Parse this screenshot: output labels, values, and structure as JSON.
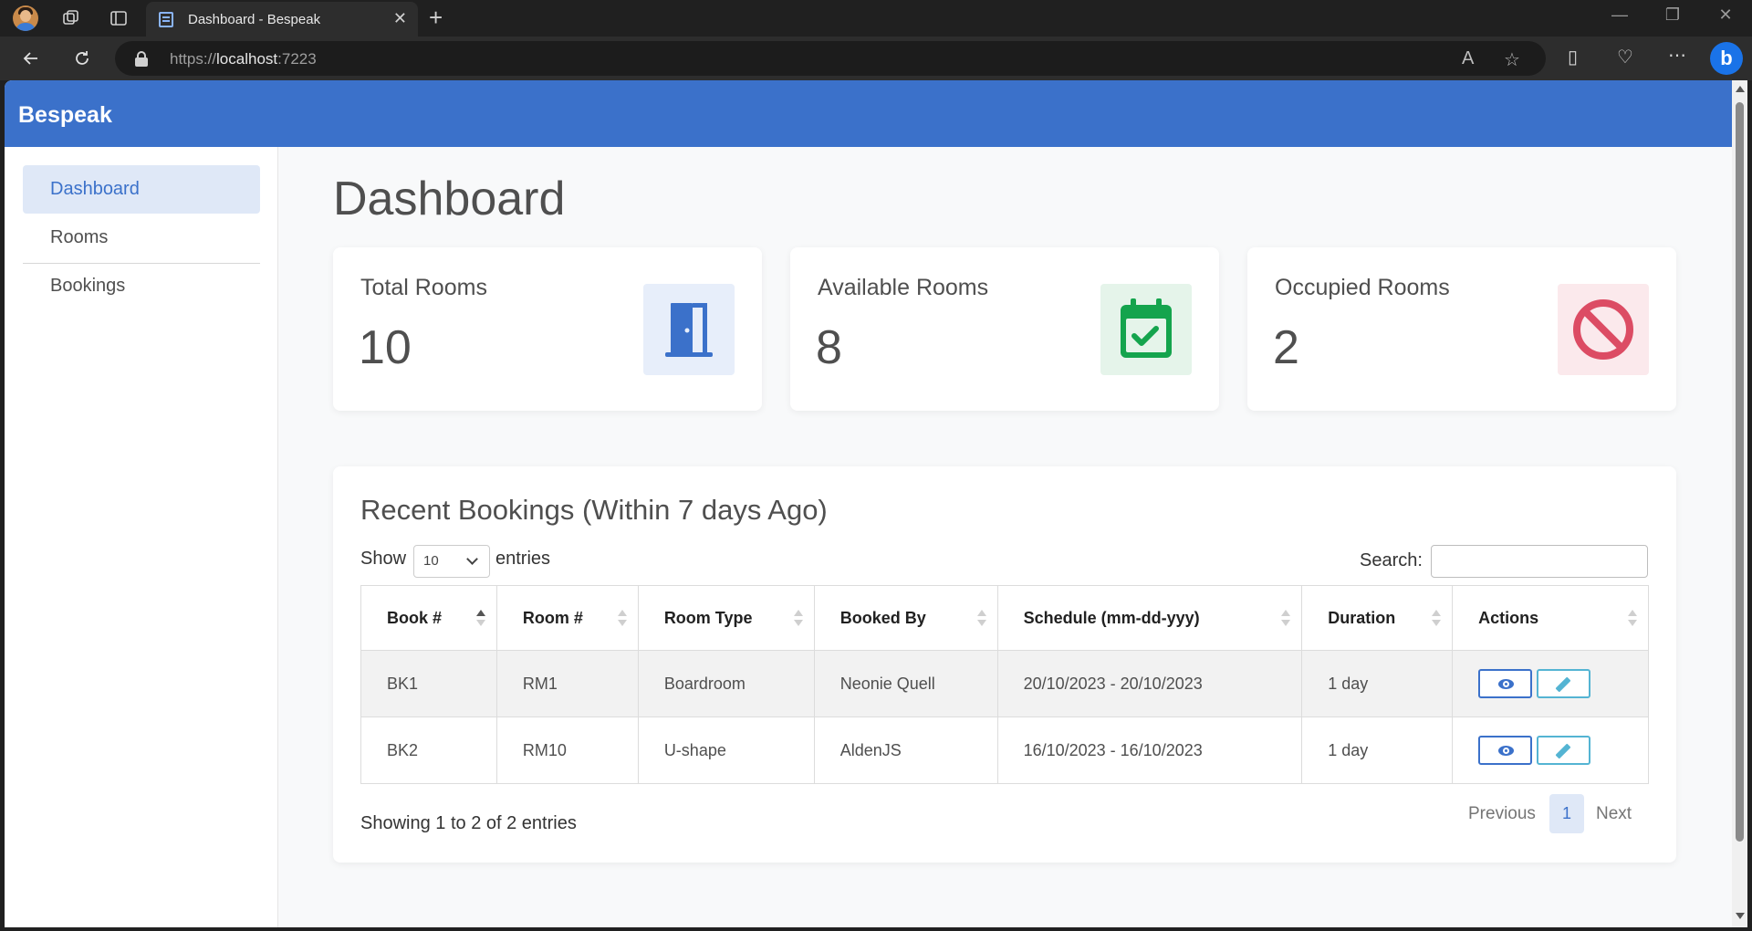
{
  "browser": {
    "tab_title": "Dashboard - Bespeak",
    "url_scheme": "https://",
    "url_host": "localhost",
    "url_port": ":7223"
  },
  "app": {
    "brand": "Bespeak"
  },
  "sidebar": {
    "items": [
      {
        "label": "Dashboard",
        "active": true
      },
      {
        "label": "Rooms",
        "active": false
      },
      {
        "label": "Bookings",
        "active": false
      }
    ]
  },
  "page": {
    "title": "Dashboard"
  },
  "stats": [
    {
      "label": "Total Rooms",
      "value": "10",
      "icon": "door-icon",
      "color": "#3b71ca",
      "bg": "#e7eefa"
    },
    {
      "label": "Available Rooms",
      "value": "8",
      "icon": "calendar-check-icon",
      "color": "#14a44d",
      "bg": "#e5f4ea"
    },
    {
      "label": "Occupied Rooms",
      "value": "2",
      "icon": "ban-icon",
      "color": "#dc4c64",
      "bg": "#fbe9ec"
    }
  ],
  "recent": {
    "title": "Recent Bookings (Within 7 days Ago)",
    "show_label": "Show",
    "page_length": "10",
    "entries_label": "entries",
    "search_label": "Search:",
    "search_value": "",
    "columns": [
      "Book #",
      "Room #",
      "Room Type",
      "Booked By",
      "Schedule (mm-dd-yyy)",
      "Duration",
      "Actions"
    ],
    "rows": [
      [
        "BK1",
        "RM1",
        "Boardroom",
        "Neonie Quell",
        "20/10/2023 - 20/10/2023",
        "1 day"
      ],
      [
        "BK2",
        "RM10",
        "U-shape",
        "AldenJS",
        "16/10/2023 - 16/10/2023",
        "1 day"
      ]
    ],
    "info": "Showing 1 to 2 of 2 entries",
    "pagination": {
      "prev": "Previous",
      "current": "1",
      "next": "Next"
    }
  },
  "colors": {
    "primary": "#3b71ca",
    "success": "#14a44d",
    "danger": "#dc4c64",
    "info": "#54b4d3"
  }
}
